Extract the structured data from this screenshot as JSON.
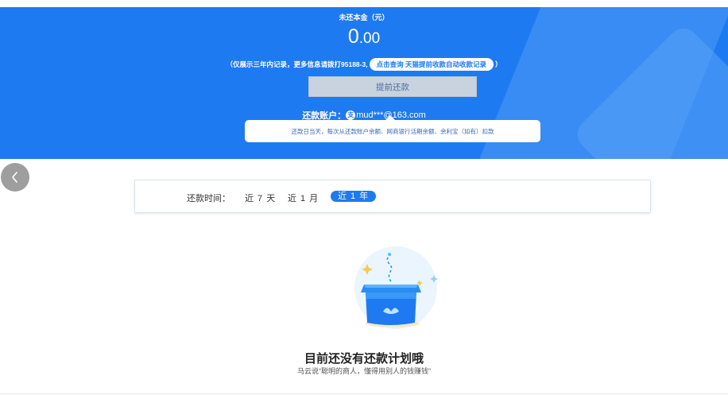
{
  "banner": {
    "principal_label": "未还本金（元）",
    "amount_int": "0",
    "amount_dec": ".00",
    "notice_prefix": "（仅展示三年内记录，更多信息请拨打95188-3,",
    "notice_link": "点击查询 天猫提前收款自动收款记录",
    "notice_suffix": "）",
    "prepay_button": "提前还款",
    "account_label": "还款账户：",
    "account_icon_glyph": "支",
    "account_value": "mud***@163.com",
    "tip_text": "还款日当天，每次从还款账户余额、网商银行活期余额、余利宝（如有）扣款",
    "colors": {
      "brand": "#1e7af0",
      "button_bg": "#c9d3e0"
    }
  },
  "filter": {
    "label": "还款时间：",
    "options": [
      "近 7 天",
      "近 1 月",
      "近 1 年"
    ],
    "selected": "近 1 年"
  },
  "empty": {
    "title": "目前还没有还款计划哦",
    "subtitle": "马云说“聪明的商人，懂得用别人的钱赚钱”",
    "icon": "empty-box-icon"
  },
  "nav": {
    "back_icon": "chevron-left-icon"
  }
}
